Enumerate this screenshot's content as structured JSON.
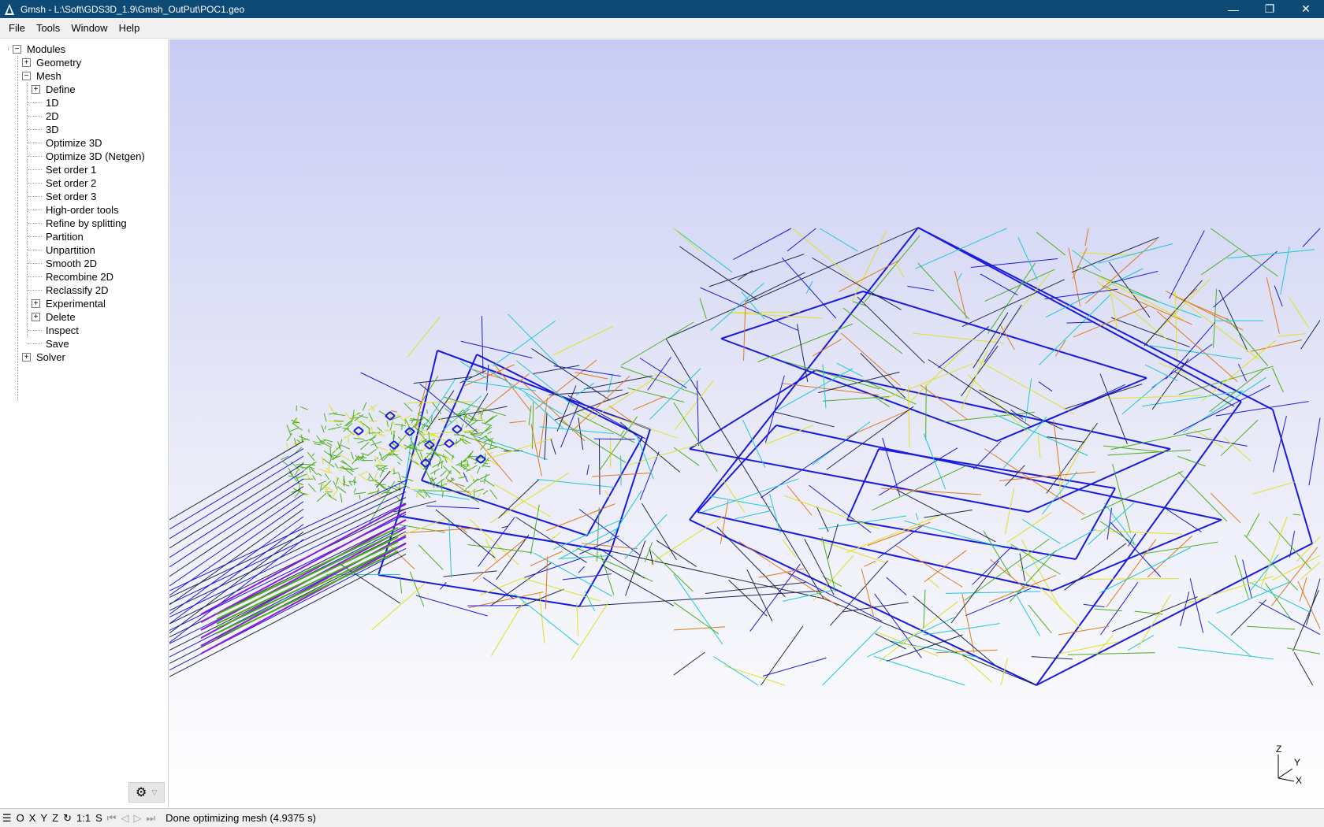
{
  "window": {
    "title": "Gmsh - L:\\Soft\\GDS3D_1.9\\Gmsh_OutPut\\POC1.geo",
    "minimize_glyph": "—",
    "restore_glyph": "❐",
    "close_glyph": "✕"
  },
  "menu": {
    "file": "File",
    "tools": "Tools",
    "window": "Window",
    "help": "Help"
  },
  "tree": {
    "modules": "Modules",
    "geometry": "Geometry",
    "mesh": "Mesh",
    "solver": "Solver",
    "mesh_items": [
      "Define",
      "1D",
      "2D",
      "3D",
      "Optimize 3D",
      "Optimize 3D (Netgen)",
      "Set order 1",
      "Set order 2",
      "Set order 3",
      "High-order tools",
      "Refine by splitting",
      "Partition",
      "Unpartition",
      "Smooth 2D",
      "Recombine 2D",
      "Reclassify 2D",
      "Experimental",
      "Delete",
      "Inspect",
      "Save"
    ],
    "plus": "+",
    "minus": "−"
  },
  "axes": {
    "z": "Z",
    "y": "Y",
    "x": "X"
  },
  "statusbar": {
    "menu_glyph": "☰",
    "o": "O",
    "x": "X",
    "y": "Y",
    "z": "Z",
    "rotate_glyph": "↻",
    "scale": "1:1",
    "s": "S",
    "first": "⏮",
    "prev": "◁",
    "play": "▷",
    "last": "⏭",
    "message": "Done optimizing mesh (4.9375 s)"
  },
  "colors": {
    "titlebar": "#0e4a76",
    "mesh_blue": "#1a1adc",
    "mesh_green": "#4cae1c",
    "mesh_yellow": "#e0e020",
    "mesh_cyan": "#1cc8d8",
    "mesh_orange": "#e0781c",
    "mesh_dark": "#202850"
  }
}
